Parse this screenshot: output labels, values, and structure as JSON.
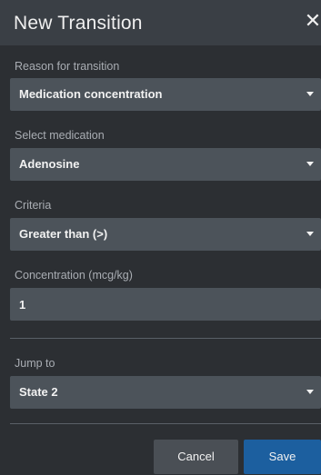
{
  "dialog": {
    "title": "New Transition",
    "close_label": "✕"
  },
  "fields": {
    "reason": {
      "label": "Reason for transition",
      "value": "Medication concentration"
    },
    "medication": {
      "label": "Select medication",
      "value": "Adenosine"
    },
    "criteria": {
      "label": "Criteria",
      "value": "Greater than (>)"
    },
    "concentration": {
      "label": "Concentration (mcg/kg)",
      "value": "1"
    },
    "jump_to": {
      "label": "Jump to",
      "value": "State 2"
    }
  },
  "footer": {
    "cancel_label": "Cancel",
    "save_label": "Save"
  },
  "colors": {
    "background": "#2c2f33",
    "field": "#4c535a",
    "primary": "#1c5f9f"
  }
}
